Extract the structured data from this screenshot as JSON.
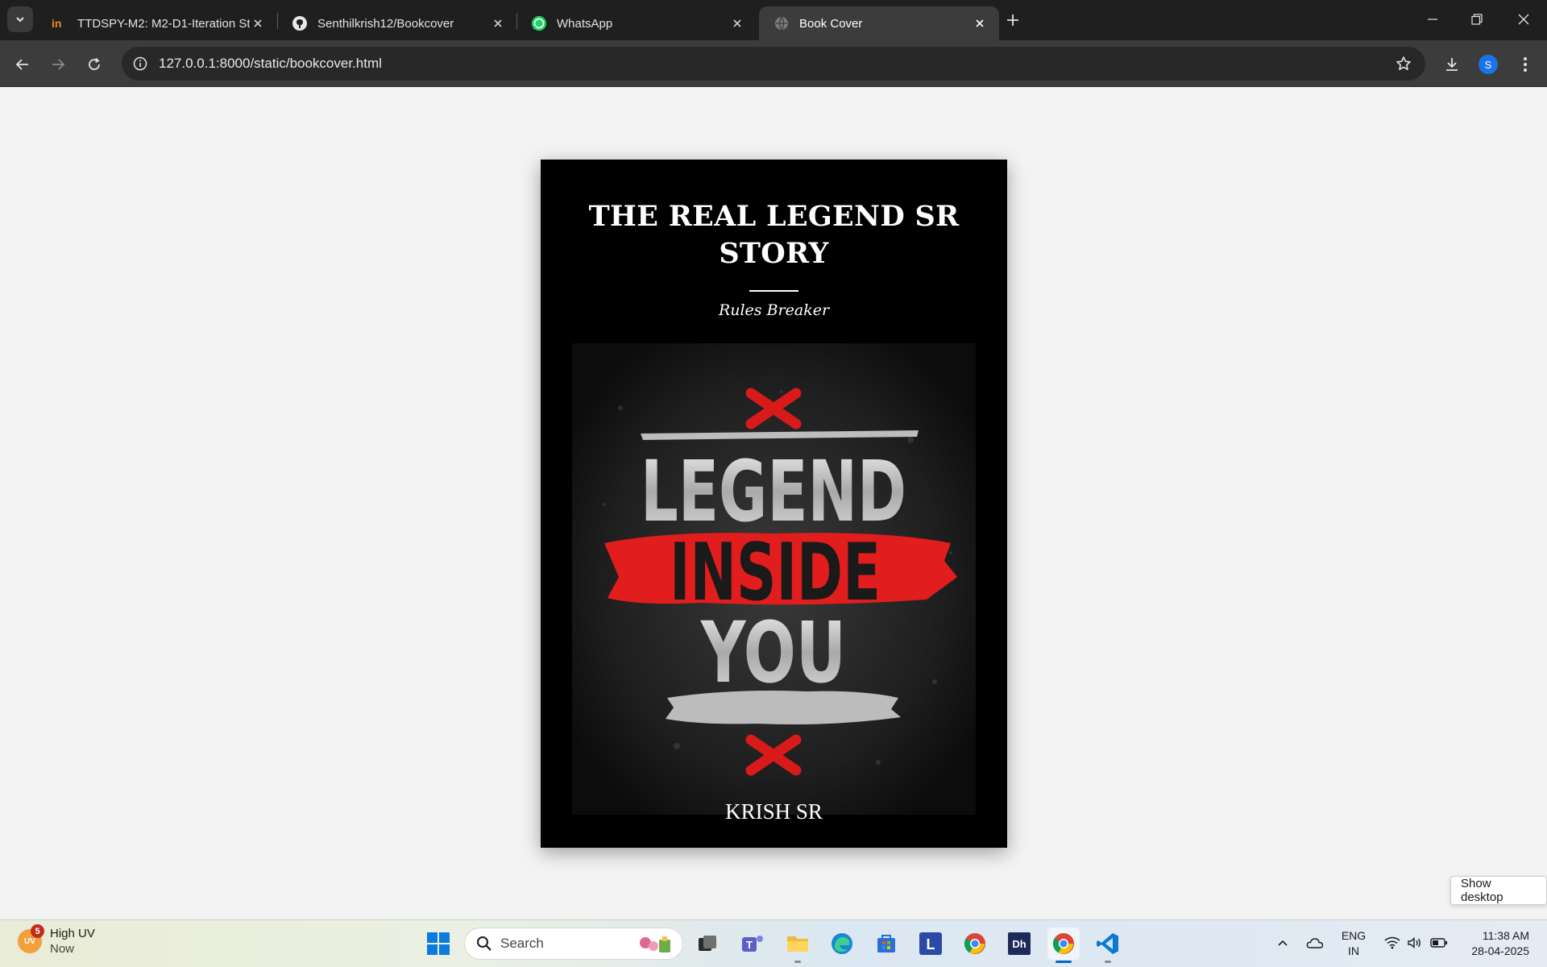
{
  "browser": {
    "tabs": [
      {
        "title": "TTDSPY-M2: M2-D1-Iteration St",
        "favicon": "in-logo-icon",
        "active": false
      },
      {
        "title": "Senthilkrish12/Bookcover",
        "favicon": "github-icon",
        "active": false
      },
      {
        "title": "WhatsApp",
        "favicon": "whatsapp-icon",
        "active": false
      },
      {
        "title": "Book Cover",
        "favicon": "globe-icon",
        "active": true
      }
    ],
    "url": "127.0.0.1:8000/static/bookcover.html",
    "profile_initial": "S"
  },
  "book": {
    "title": "THE REAL LEGEND SR STORY",
    "subtitle": "Rules Breaker",
    "author": "KRISH SR",
    "cover_art_text": {
      "line1": "LEGEND",
      "line2": "INSIDE",
      "line3": "YOU"
    },
    "colors": {
      "background": "#000000",
      "accent": "#e11d1d",
      "silver": "#cfcfcf"
    }
  },
  "tooltip": {
    "show_desktop": "Show desktop"
  },
  "taskbar": {
    "weather": {
      "badge": "5",
      "icon_text": "UV",
      "title": "High UV",
      "sub": "Now"
    },
    "search_placeholder": "Search",
    "tray": {
      "lang_top": "ENG",
      "lang_bottom": "IN"
    },
    "clock": {
      "time": "11:38 AM",
      "date": "28-04-2025"
    }
  }
}
